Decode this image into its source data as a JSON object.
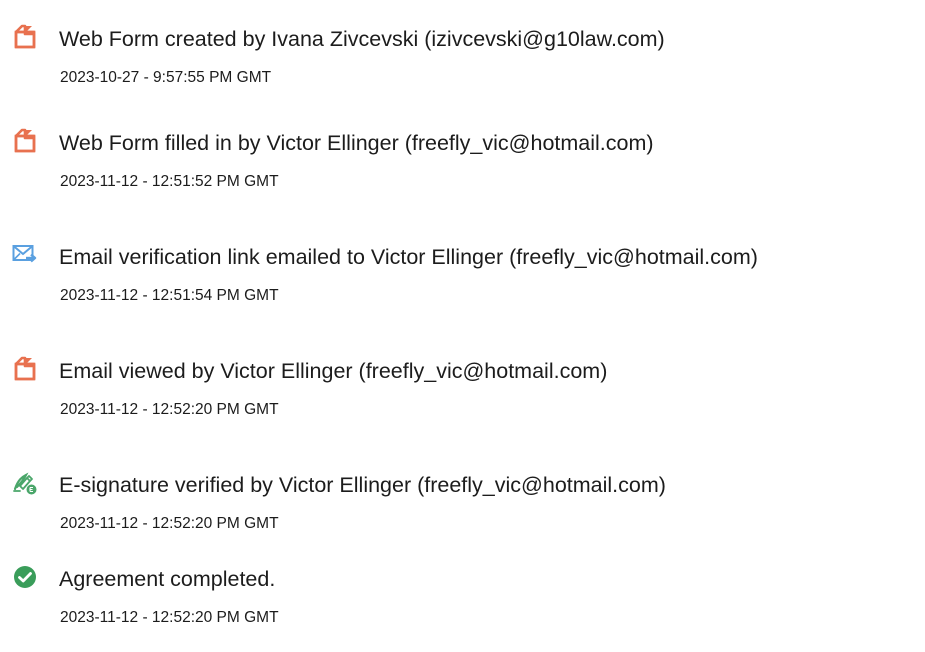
{
  "events": [
    {
      "icon": "document-created-icon",
      "description": "Web Form created by Ivana Zivcevski (izivcevski@g10law.com)",
      "timestamp": "2023-10-27 - 9:57:55 PM GMT"
    },
    {
      "icon": "document-created-icon",
      "description": "Web Form filled in by Victor Ellinger (freefly_vic@hotmail.com)",
      "timestamp": "2023-11-12 - 12:51:52 PM GMT"
    },
    {
      "icon": "email-sent-icon",
      "description": "Email verification link emailed to Victor Ellinger (freefly_vic@hotmail.com)",
      "timestamp": "2023-11-12 - 12:51:54 PM GMT"
    },
    {
      "icon": "document-created-icon",
      "description": "Email viewed by Victor Ellinger (freefly_vic@hotmail.com)",
      "timestamp": "2023-11-12 - 12:52:20 PM GMT"
    },
    {
      "icon": "esignature-icon",
      "description": "E-signature verified by Victor Ellinger (freefly_vic@hotmail.com)",
      "timestamp": "2023-11-12 - 12:52:20 PM GMT"
    },
    {
      "icon": "check-circle-icon",
      "description": "Agreement completed.",
      "timestamp": "2023-11-12 - 12:52:20 PM GMT"
    }
  ],
  "colors": {
    "orange_doc": "#e8714f",
    "email_blue": "#5aa0e0",
    "sig_green": "#4aa66a",
    "check_green": "#3a9d5a"
  }
}
